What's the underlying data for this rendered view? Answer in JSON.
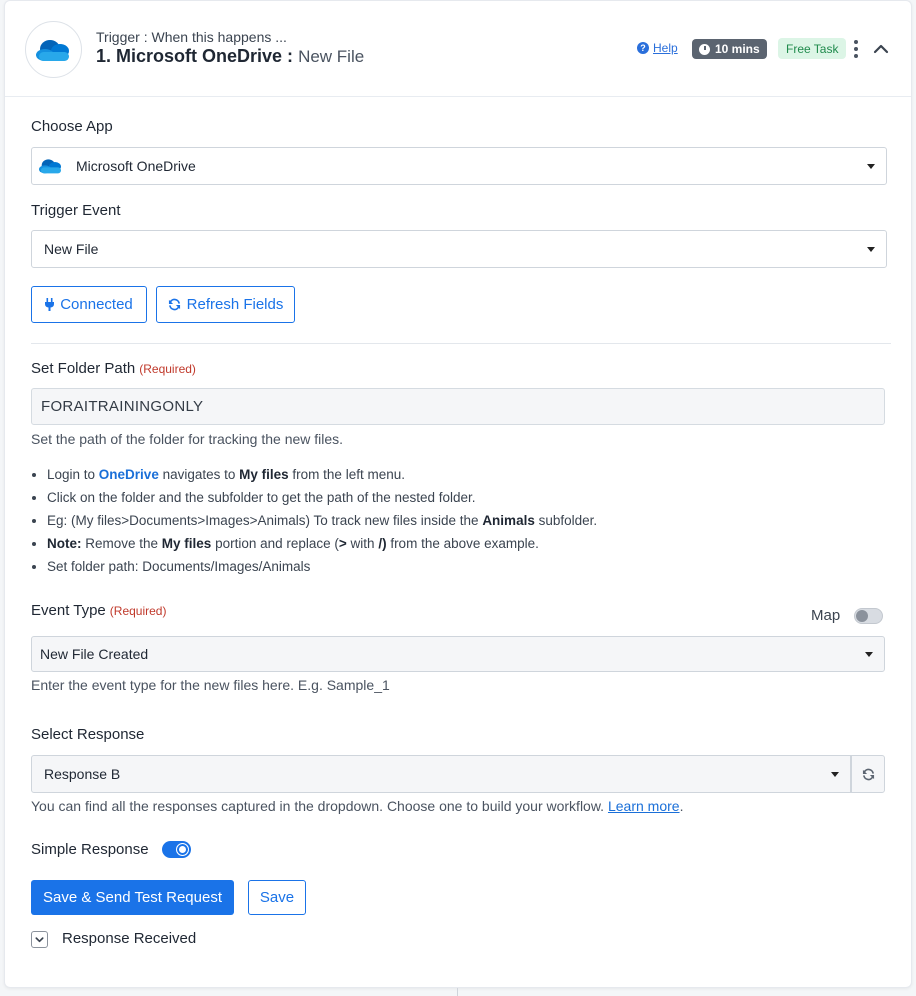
{
  "header": {
    "subtitle": "Trigger : When this happens ...",
    "title_main": "1. Microsoft OneDrive :",
    "title_event": "New File",
    "help_label": "Help",
    "help_icon_glyph": "?",
    "time_label": "10 mins",
    "free_label": "Free Task",
    "icons": [
      "onedrive-logo-icon",
      "help-icon",
      "clock-icon",
      "more-vertical-icon",
      "chevron-up-icon"
    ]
  },
  "choose_app": {
    "label": "Choose App",
    "value": "Microsoft OneDrive"
  },
  "trigger_event": {
    "label": "Trigger Event",
    "value": "New File"
  },
  "buttons": {
    "connected": "Connected",
    "refresh_fields": "Refresh Fields"
  },
  "folder_path": {
    "label": "Set Folder Path",
    "required": "(Required)",
    "value": "FORAITRAININGONLY",
    "helper": "Set the path of the folder for tracking the new files."
  },
  "instructions": {
    "b1_pre": "Login to ",
    "b1_link": "OneDrive",
    "b1_mid": " navigates to ",
    "b1_bold": "My files",
    "b1_post": " from the left menu.",
    "b2": "Click on the folder and the subfolder to get the path of the nested folder.",
    "b3_pre": "Eg: (My files>Documents>Images>Animals) To track new files inside the ",
    "b3_bold": "Animals",
    "b3_post": " subfolder.",
    "b4_note": "Note:",
    "b4_pre": " Remove the ",
    "b4_bold1": "My files",
    "b4_mid": " portion and replace (",
    "b4_bold2": ">",
    "b4_mid2": " with ",
    "b4_bold3": "/)",
    "b4_post": " from the above example.",
    "b5": "Set folder path: Documents/Images/Animals"
  },
  "event_type": {
    "label": "Event Type",
    "required": "(Required)",
    "map_label": "Map",
    "value": "New File Created",
    "helper": "Enter the event type for the new files here. E.g. Sample_1"
  },
  "select_response": {
    "label": "Select Response",
    "value": "Response B",
    "helper": "You can find all the responses captured in the dropdown. Choose one to build your workflow.",
    "learn_more": "Learn more",
    "helper_end": "."
  },
  "simple_response": {
    "label": "Simple Response",
    "enabled": true
  },
  "actions": {
    "save_send": "Save & Send Test Request",
    "save": "Save"
  },
  "response_received": {
    "label": "Response Received"
  },
  "colors": {
    "accent": "#1a73e8",
    "required": "#c0392b",
    "free_badge_bg": "#dcf5e6",
    "free_badge_text": "#1f8a4c",
    "time_badge_bg": "#5b6470"
  }
}
